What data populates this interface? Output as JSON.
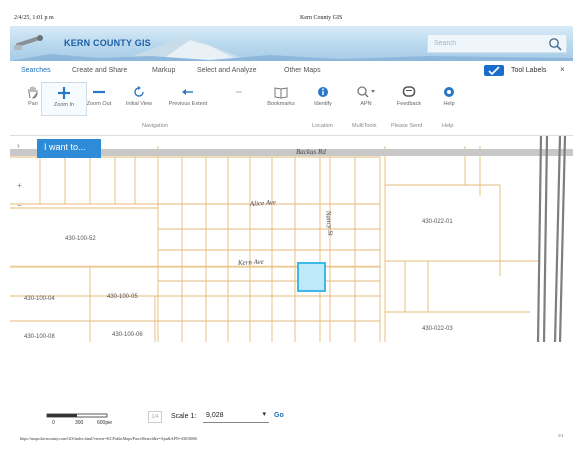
{
  "print": {
    "date": "2/4/25, 1:01 p m",
    "title": "Kern County GIS",
    "url": "https://maps.kerncounty.com/GIS/index.html?viewer=KCPublicMaps/ParcelSearch&e=Apn&APN=43010006",
    "page": "1/1"
  },
  "header": {
    "brand": "KERN COUNTY GIS",
    "search_placeholder": "Search",
    "brand_color": "#1d5fa5"
  },
  "menu": {
    "tabs": [
      "Searches",
      "Create and Share",
      "Markup",
      "Select and Analyze",
      "Other Maps"
    ],
    "active_tab": "Searches",
    "tool_labels": "Tool Labels",
    "close": "×"
  },
  "toolbar": {
    "tools": [
      {
        "label": "Pan",
        "icon": "hand-icon"
      },
      {
        "label": "Zoom In",
        "icon": "plus-icon"
      },
      {
        "label": "Zoom Out",
        "icon": "minus-icon"
      },
      {
        "label": "Initial View",
        "icon": "refresh-icon"
      },
      {
        "label": "Previous Extent",
        "icon": "back-arrow-icon"
      },
      {
        "label": "Bookmarks",
        "icon": "book-icon"
      },
      {
        "label": "Identify",
        "icon": "info-icon"
      },
      {
        "label": "APN",
        "icon": "magnifier-icon"
      },
      {
        "label": "Feedback",
        "icon": "feedback-icon"
      },
      {
        "label": "Help",
        "icon": "help-icon"
      }
    ],
    "groups": [
      "Navigation",
      "Location",
      "MultiTools",
      "Please Send",
      "Help"
    ]
  },
  "map": {
    "i_want_to": "I want to...",
    "streets": [
      "Backus Rd",
      "Alice Ave",
      "Kern Ave",
      "Nancy St"
    ],
    "parcels": [
      "430-100-52",
      "430-100-04",
      "430-100-05",
      "430-100-08",
      "430-100-06",
      "430-022-01",
      "430-022-03"
    ],
    "side_tools": [
      "›",
      "+",
      "−"
    ],
    "highlight_color": "#3db8ea",
    "parcel_line_color": "#e7b97a"
  },
  "footer": {
    "scale_ticks": [
      "0",
      "300",
      "600pie"
    ],
    "scale_label": "Scale 1:",
    "scale_value": "9,028",
    "go": "Go",
    "small_box": "1/4"
  }
}
